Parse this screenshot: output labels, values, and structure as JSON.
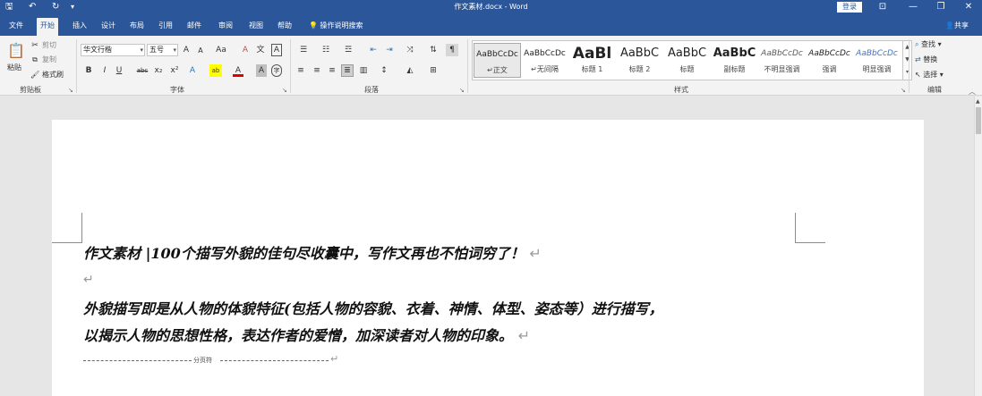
{
  "titlebar": {
    "title": "作文素材.docx - Word",
    "login": "登录",
    "quick_access": {
      "save": "🖫",
      "undo": "↶",
      "redo": "↻",
      "customize": "▾"
    },
    "window_buttons": {
      "ribbon_options": "⊡",
      "minimize": "—",
      "maximize": "❐",
      "close": "✕"
    }
  },
  "tabs": [
    "文件",
    "开始",
    "插入",
    "设计",
    "布局",
    "引用",
    "邮件",
    "审阅",
    "视图",
    "帮助"
  ],
  "tell_me": "操作说明搜索",
  "share": "共享",
  "ribbon": {
    "clipboard": {
      "paste": "粘贴",
      "cut": "剪切",
      "copy": "复制",
      "format_painter": "格式刷",
      "label": "剪贴板"
    },
    "font": {
      "font_name": "华文行楷",
      "font_size": "五号",
      "grow": "A",
      "shrink": "A",
      "change_case": "Aa",
      "clear": "A",
      "phonetic": "文",
      "border": "A",
      "bold": "B",
      "italic": "I",
      "underline": "U",
      "strike": "abc",
      "subscript": "x₂",
      "superscript": "x²",
      "text_effects": "A",
      "highlight": "ab",
      "font_color": "A",
      "char_shading": "A",
      "enclose": "字",
      "label": "字体"
    },
    "paragraph": {
      "label": "段落"
    },
    "styles": {
      "items": [
        {
          "sample": "AaBbCcDc",
          "name": "↵正文"
        },
        {
          "sample": "AaBbCcDc",
          "name": "↵无间隔"
        },
        {
          "sample": "AaBl",
          "name": "标题 1"
        },
        {
          "sample": "AaBbC",
          "name": "标题 2"
        },
        {
          "sample": "AaBbC",
          "name": "标题"
        },
        {
          "sample": "AaBbC",
          "name": "副标题"
        },
        {
          "sample": "AaBbCcDc",
          "name": "不明显强调"
        },
        {
          "sample": "AaBbCcDc",
          "name": "强调"
        },
        {
          "sample": "AaBbCcDc",
          "name": "明显强调"
        }
      ],
      "label": "样式"
    },
    "editing": {
      "find": "查找",
      "replace": "替换",
      "select": "选择",
      "label": "编辑"
    }
  },
  "document": {
    "line1": "作文素材",
    "line1_rest": "|100个描写外貌的佳句尽收囊中，写作文再也不怕词穷了！",
    "para_mark": "↵",
    "line3": "外貌描写即是从人物的体貌特征(包括人物的容貌、衣着、神情、体型、姿态等）进行描写，",
    "line4": "以揭示人物的思想性格，表达作者的爱憎，加深读者对人物的印象。",
    "page_break": "分页符"
  }
}
